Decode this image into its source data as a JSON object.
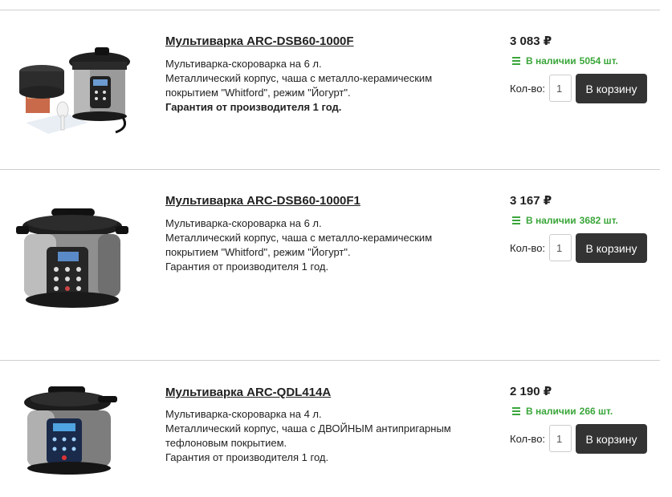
{
  "products": [
    {
      "title": "Мультиварка ARC-DSB60-1000F",
      "desc": [
        "Мультиварка-скороварка на 6 л.",
        "Металлический корпус, чаша с металло-керамическим",
        "покрытием \"Whitford\", режим \"Йогурт\".",
        "Гарантия от производителя 1 год."
      ],
      "price": "3 083 ₽",
      "stock_label": "В наличии",
      "stock_count": "5054 шт.",
      "qty_label": "Кол-во:",
      "qty_value": "1",
      "cart_label": "В корзину",
      "icon": "pressure-cooker-set-image"
    },
    {
      "title": "Мультиварка ARC-DSB60-1000F1",
      "desc": [
        "Мультиварка-скороварка на 6 л.",
        "Металлический корпус, чаша с металло-керамическим",
        "покрытием \"Whitford\", режим \"Йогурт\".",
        "Гарантия от производителя 1 год."
      ],
      "price": "3 167 ₽",
      "stock_label": "В наличии",
      "stock_count": "3682 шт.",
      "qty_label": "Кол-во:",
      "qty_value": "1",
      "cart_label": "В корзину",
      "icon": "pressure-cooker-image"
    },
    {
      "title": "Мультиварка ARC-QDL414A",
      "desc": [
        "Мультиварка-скороварка на 4 л.",
        "Металлический корпус, чаша с ДВОЙНЫМ антипригарным",
        "тефлоновым покрытием.",
        "Гарантия от производителя 1 год."
      ],
      "price": "2 190 ₽",
      "stock_label": "В наличии",
      "stock_count": "266 шт.",
      "qty_label": "Кол-во:",
      "qty_value": "1",
      "cart_label": "В корзину",
      "icon": "pressure-cooker-image"
    }
  ],
  "colors": {
    "stock_green": "#3aa63a",
    "button_bg": "#333333",
    "divider": "#cfcfcf"
  }
}
